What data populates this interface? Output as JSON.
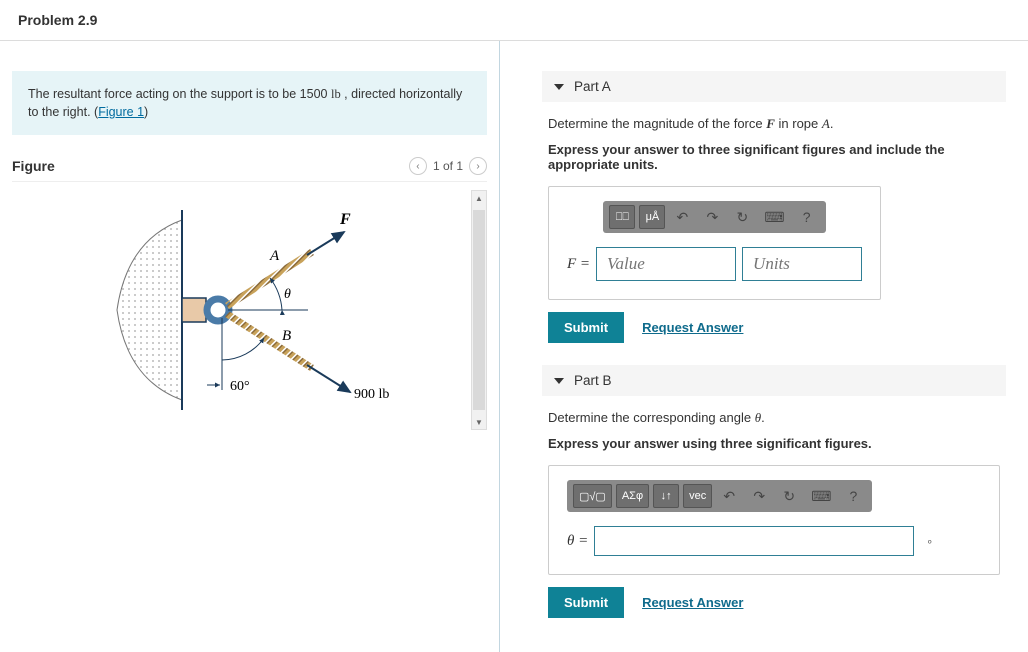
{
  "header": {
    "title": "Problem 2.9"
  },
  "prompt": {
    "text_before": "The resultant force acting on the support is to be 1500 ",
    "unit": "lb",
    "text_mid": " , directed horizontally to the right. (",
    "link": "Figure 1",
    "text_after": ")"
  },
  "figure": {
    "heading": "Figure",
    "pager_label": "1 of 1",
    "labels": {
      "F": "F",
      "A": "A",
      "B": "B",
      "theta": "θ",
      "angle": "60°",
      "load": "900 lb"
    }
  },
  "partA": {
    "title": "Part A",
    "question_before": "Determine the magnitude of the force ",
    "question_F": "F",
    "question_mid": " in rope ",
    "question_A": "A",
    "question_after": ".",
    "instruction": "Express your answer to three significant figures and include the appropriate units.",
    "lhs": "F =",
    "value_placeholder": "Value",
    "units_placeholder": "Units",
    "toolbar": {
      "tpl": "⎕⎕",
      "mu": "μÅ",
      "undo": "↶",
      "redo": "↷",
      "reset": "↻",
      "kbd": "⌨",
      "help": "?"
    },
    "submit": "Submit",
    "request": "Request Answer"
  },
  "partB": {
    "title": "Part B",
    "question_before": "Determine the corresponding angle ",
    "question_theta": "θ",
    "question_after": ".",
    "instruction": "Express your answer using three significant figures.",
    "lhs": "θ =",
    "unit_suffix": "∘",
    "toolbar": {
      "tpl": "▢√▢",
      "greek": "ΑΣφ",
      "frac": "↓↑",
      "vec": "vec",
      "undo": "↶",
      "redo": "↷",
      "reset": "↻",
      "kbd": "⌨",
      "help": "?"
    },
    "submit": "Submit",
    "request": "Request Answer"
  }
}
